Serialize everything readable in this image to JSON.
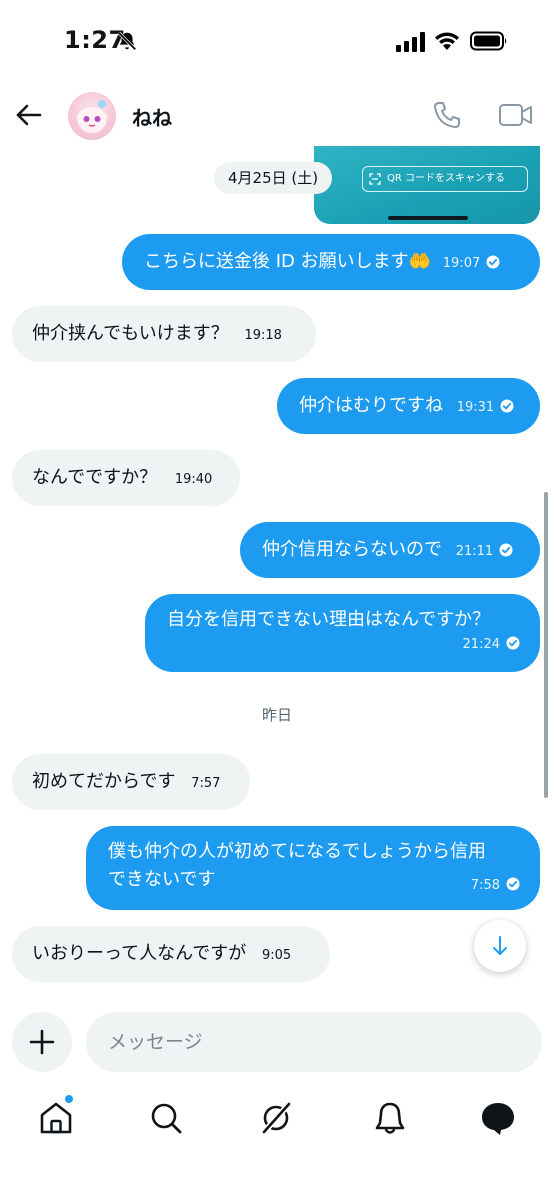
{
  "status": {
    "time": "1:27",
    "icons": [
      "bell-slash-icon",
      "signal-icon",
      "wifi-icon",
      "battery-icon"
    ]
  },
  "header": {
    "name": "ねね",
    "icons": [
      "back-arrow-icon",
      "phone-icon",
      "video-icon"
    ]
  },
  "shared_card": {
    "scan_label": "QR コードをスキャンする"
  },
  "date_chip": "4月25日 (土)",
  "messages": [
    {
      "dir": "out",
      "text": "こちらに送金後 ID お願いします🤲",
      "time": "19:07"
    },
    {
      "dir": "in",
      "text": "仲介挟んでもいけます？",
      "time": "19:18"
    },
    {
      "dir": "out",
      "text": "仲介はむりですね",
      "time": "19:31"
    },
    {
      "dir": "in",
      "text": "なんでですか？",
      "time": "19:40"
    },
    {
      "dir": "out",
      "text": "仲介信用ならないので",
      "time": "21:11"
    },
    {
      "dir": "out",
      "text": "自分を信用できない理由はなんですか？",
      "time": "21:24"
    },
    {
      "dir": "in",
      "text": "初めてだからです",
      "time": "7:57"
    },
    {
      "dir": "out",
      "text": "僕も仲介の人が初めてになるでしょうから信用",
      "text2": "できないです",
      "time": "7:58"
    },
    {
      "dir": "in",
      "text": "いおりーって人なんですが",
      "time": "9:05"
    }
  ],
  "day_separator": "昨日",
  "composer": {
    "placeholder": "メッセージ"
  },
  "nav": [
    "home-icon",
    "search-icon",
    "grok-icon",
    "notifications-icon",
    "messages-icon"
  ],
  "colors": {
    "accent": "#1d9bf0",
    "incoming_bubble": "#eff3f4",
    "text": "#0f1419",
    "muted": "#536471"
  }
}
